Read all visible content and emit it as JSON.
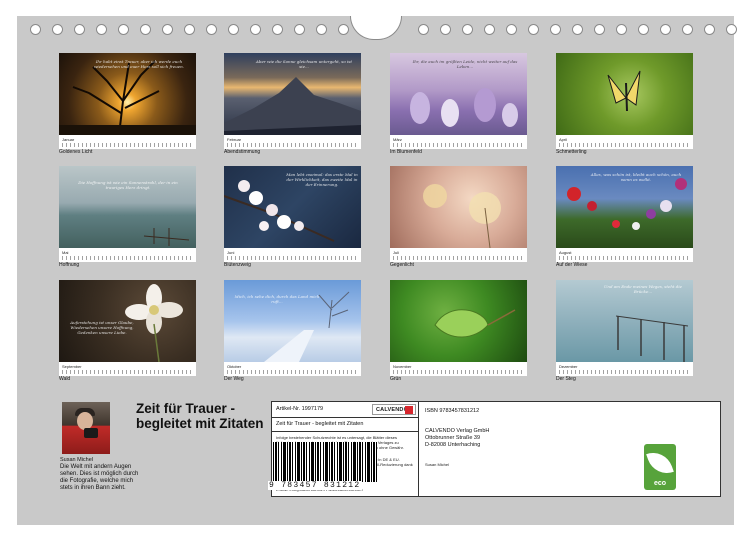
{
  "calendar": {
    "title": "Zeit für Trauer - begleitet mit Zitaten",
    "author": "Susan Michel",
    "author_bio": "Die Welt mit andern Augen sehen. Dies ist möglich durch die Fotografie, welche mich stets in ihren Bann zieht."
  },
  "months": [
    {
      "month": "Januar",
      "caption": "Goldenes Licht",
      "quote": "Ihr habt einst Trauer, aber ich werde euch wiedersehen und euer Herz soll sich freuen."
    },
    {
      "month": "Februar",
      "caption": "Abendstimmung",
      "quote": "Aber wie die Sonne gleichsam untergeht, so ist sie..."
    },
    {
      "month": "März",
      "caption": "Im Blumenfeld",
      "quote": "Ihr, die auch im größten Leide, nicht weiter auf das Leben..."
    },
    {
      "month": "April",
      "caption": "Schmetterling",
      "quote": ""
    },
    {
      "month": "Mai",
      "caption": "Hoffnung",
      "quote": "Die Hoffnung ist wie ein Sonnenstrahl, der in ein trauriges Herz dringt."
    },
    {
      "month": "Juni",
      "caption": "Blütenzweig",
      "quote": "Man lebt zweimal: das erste Mal in der Wirklichkeit, das zweite Mal in der Erinnerung."
    },
    {
      "month": "Juli",
      "caption": "Gegenlicht",
      "quote": ""
    },
    {
      "month": "August",
      "caption": "Auf der Wiese",
      "quote": "Alles, was schön ist, bleibt auch schön, auch wenn es welkt."
    },
    {
      "month": "September",
      "caption": "Wald",
      "quote": "Auferstehung ist unser Glaube, Wiedersehen unsere Hoffnung, Gedenken unsere Liebe."
    },
    {
      "month": "Oktober",
      "caption": "Der Weg",
      "quote": "Mich, ich sehe dich, durch das Land mich ruft..."
    },
    {
      "month": "November",
      "caption": "Grün",
      "quote": ""
    },
    {
      "month": "Dezember",
      "caption": "Der Steg",
      "quote": "Und am Ende meines Weges, steht die Brücke..."
    }
  ],
  "info": {
    "article": "Artikel-Nr. 1997179",
    "product_title": "Zeit für Trauer - begleitet mit Zitaten",
    "legal": "Infolge bestehender Schutzrechte ist es untersagt, die Blätter dieses Kalenders herauszutrennen und ohne Genehmigung des Verlages zu gewerblichen Zwecken weiterzuverwenden. Alle Angaben ohne Gewähr.",
    "production": "CALVENDO produziert bedarfsgerecht und klimabewusst in DE & EU. Positivere CO2-Bilanz durch kurzen Transportwege. Abfall-Reduzierung dank Einzelstückfertigung.",
    "email": "E-Mail: info@calvendo.com • www.calvendo.com",
    "logo": "CALVENDO",
    "isbn": "ISBN 9783457831212",
    "publisher": [
      "CALVENDO Verlag GmbH",
      "Ottobrunner Straße 39",
      "D-82008 Unterhaching"
    ],
    "author_small": "Susan Michel",
    "barcode_digits": "9 783457 831212",
    "eco_label": "eco"
  },
  "colors": {
    "sheet": "#c9c9c9",
    "eco": "#57a33b",
    "logo_accent": "#d7262d"
  }
}
